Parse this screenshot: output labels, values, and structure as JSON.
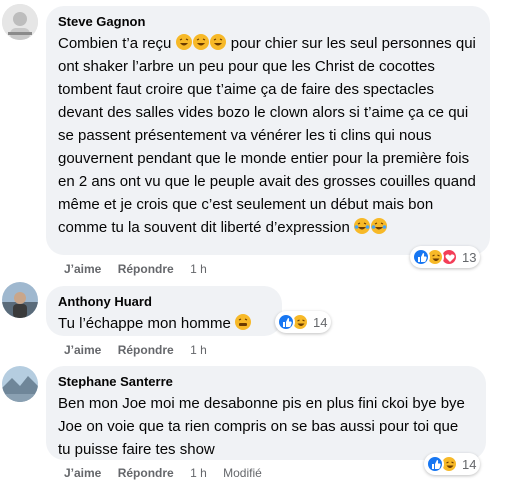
{
  "comments": [
    {
      "author": "Steve Gagnon",
      "text_a": "Combien t’a reçu ",
      "text_b": "pour chier sur les seul personnes qui ont shaker l’arbre un peu pour que les Christ de cocottes tombent faut croire que t’aime ça de faire des spectacles devant des salles vides bozo le clown alors si t’aime ça ce qui se passent présentement va vénérer les ti clins qui nous gouvernent pendant que le monde entier pour la première fois en 2 ans ont vu que le peuple avait des grosses couilles quand même et je crois que c’est seulement un début mais bon comme tu la souvent dit liberté d’expression ",
      "like": "J’aime",
      "reply": "Répondre",
      "time": "1 h",
      "reaction_count": "13"
    },
    {
      "author": "Anthony Huard",
      "text_a": "Tu l’échappe mon homme ",
      "like": "J’aime",
      "reply": "Répondre",
      "time": "1 h",
      "reaction_count": "14"
    },
    {
      "author": "Stephane Santerre",
      "text_a": "Ben mon Joe moi me desabonne pis en plus fini ckoi bye bye Joe on voie que ta rien compris on se bas aussi pour toi que tu puisse faire tes show",
      "like": "J’aime",
      "reply": "Répondre",
      "time": "1 h",
      "edited": "Modifié",
      "reaction_count": "14"
    }
  ],
  "colors": {
    "bubble": "#f0f2f5",
    "meta": "#65676b",
    "like": "#1877f2",
    "haha": "#f7b928",
    "love": "#f33e58"
  },
  "icons": [
    "avatar",
    "like-icon",
    "haha-icon",
    "love-icon",
    "laughing-emoji-icon",
    "tears-emoji-icon"
  ]
}
